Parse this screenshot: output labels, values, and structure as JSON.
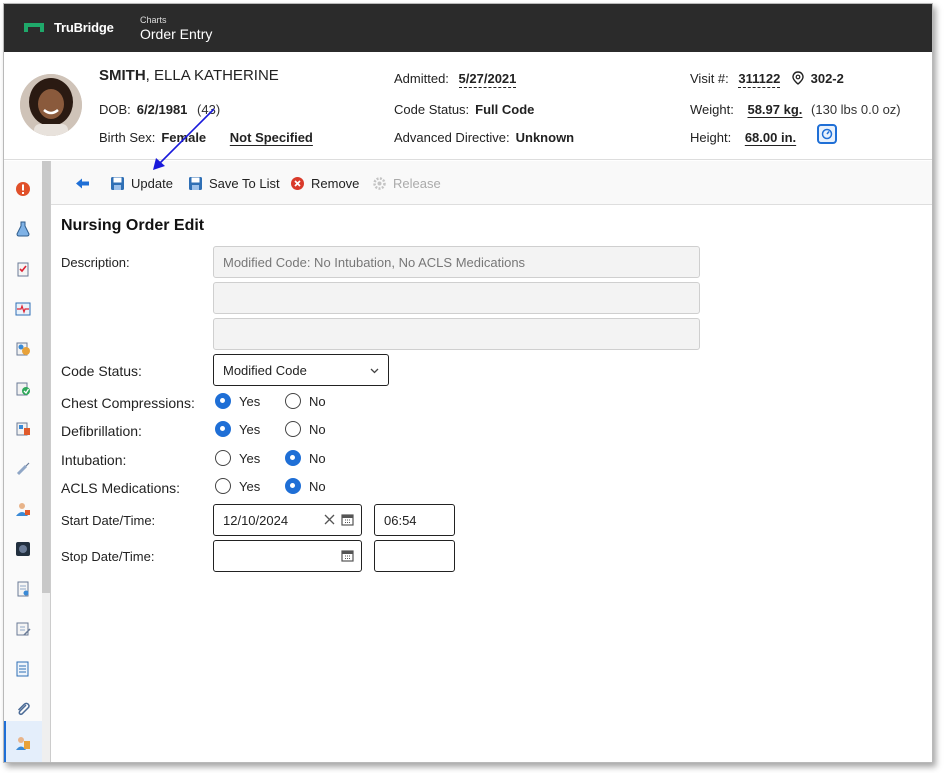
{
  "app": {
    "brand": "TruBridge",
    "module_small": "Charts",
    "module_title": "Order Entry"
  },
  "patient": {
    "last_name": "SMITH",
    "first_names": ", ELLA KATHERINE",
    "dob_label": "DOB:",
    "dob": "6/2/1981",
    "age": "(43)",
    "birth_sex_label": "Birth Sex:",
    "birth_sex": "Female",
    "gender": "Not Specified",
    "admitted_label": "Admitted:",
    "admitted": "5/27/2021",
    "code_status_label": "Code Status:",
    "code_status": "Full Code",
    "adv_dir_label": "Advanced Directive:",
    "adv_dir": "Unknown",
    "visit_label": "Visit #:",
    "visit": "311122",
    "room": "302-2",
    "weight_label": "Weight:",
    "weight": "58.97 kg.",
    "weight_alt": "(130 lbs 0.0 oz)",
    "height_label": "Height:",
    "height": "68.00 in."
  },
  "toolbar": {
    "update": "Update",
    "save_to_list": "Save To List",
    "remove": "Remove",
    "release": "Release"
  },
  "form": {
    "title": "Nursing Order Edit",
    "description_label": "Description:",
    "description_line1": "Modified Code: No Intubation, No ACLS Medications",
    "description_line2": "",
    "description_line3": "",
    "code_status_label": "Code Status:",
    "code_status_value": "Modified Code",
    "yes": "Yes",
    "no": "No",
    "chest_label": "Chest Compressions:",
    "defib_label": "Defibrillation:",
    "intubation_label": "Intubation:",
    "acls_label": "ACLS Medications:",
    "start_label": "Start Date/Time:",
    "start_date": "12/10/2024",
    "start_time": "06:54",
    "stop_label": "Stop Date/Time:",
    "stop_date": "",
    "stop_time": ""
  },
  "colors": {
    "accent": "#1f6fd6",
    "topbar": "#2b2b2b",
    "logo": "#1fa86a",
    "annotation_arrow": "#1a1adb"
  }
}
